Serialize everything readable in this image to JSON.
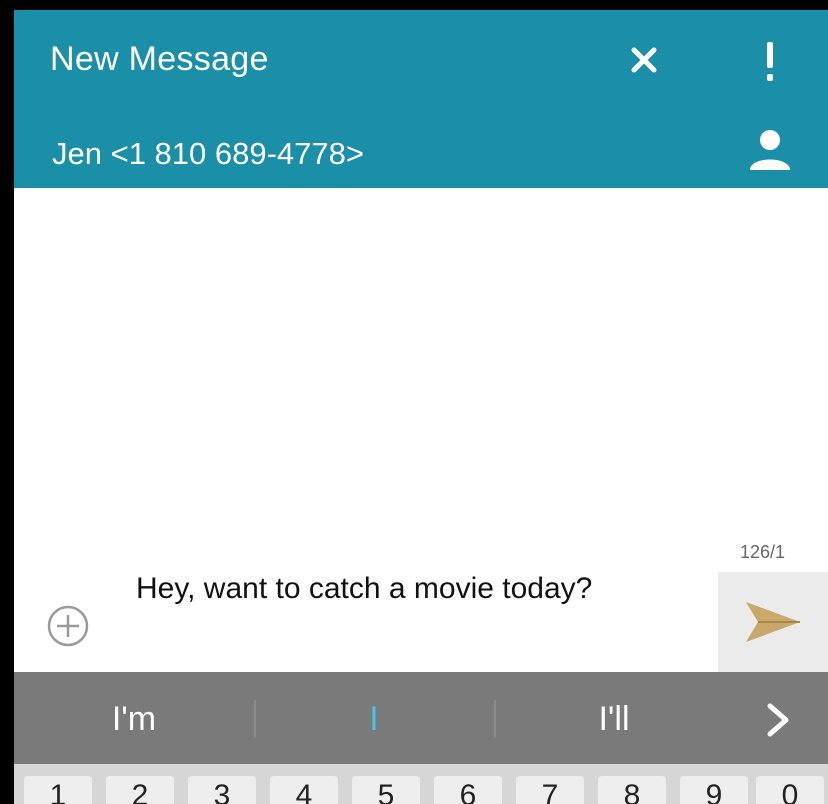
{
  "header": {
    "title": "New Message",
    "recipient": "Jen <1 810 689-4778>",
    "icons": {
      "close": "close-icon",
      "more": "more-vert-icon",
      "contact": "person-icon"
    }
  },
  "compose": {
    "counter": "126/1",
    "message": "Hey, want to catch a movie today?",
    "icons": {
      "attach": "add-circle-icon",
      "send": "send-icon"
    }
  },
  "keyboard": {
    "suggestions": [
      "I'm",
      "I",
      "I'll"
    ],
    "expand_icon": "chevron-right-icon",
    "number_keys": [
      "1",
      "2",
      "3",
      "4",
      "5",
      "6",
      "7",
      "8",
      "9",
      "0"
    ]
  },
  "colors": {
    "appbar": "#1b8fa8",
    "suggest_bar": "#7a7a7a",
    "highlight_suggestion": "#4cc1e6",
    "send_icon": "#c9a86a"
  }
}
